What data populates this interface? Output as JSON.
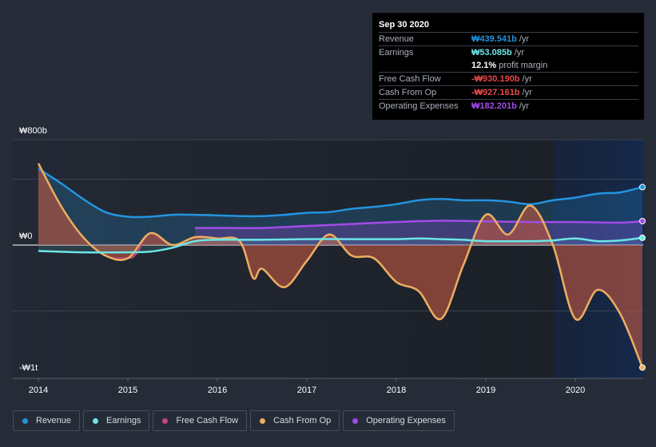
{
  "tooltip": {
    "date": "Sep 30 2020",
    "rows": [
      {
        "label": "Revenue",
        "value": "₩439.541b",
        "unit": "/yr",
        "color": "#2394df"
      },
      {
        "label": "Earnings",
        "value": "₩53.085b",
        "unit": "/yr",
        "color": "#6ce5e8"
      },
      {
        "label": "",
        "value": "12.1%",
        "unit": "profit margin",
        "color": "#ffffff"
      },
      {
        "label": "Free Cash Flow",
        "value": "-₩930.190b",
        "unit": "/yr",
        "color": "#e84a4a"
      },
      {
        "label": "Cash From Op",
        "value": "-₩927.161b",
        "unit": "/yr",
        "color": "#e84a4a"
      },
      {
        "label": "Operating Expenses",
        "value": "₩182.201b",
        "unit": "/yr",
        "color": "#a24be8"
      }
    ]
  },
  "legend": [
    {
      "label": "Revenue",
      "color": "#2394df"
    },
    {
      "label": "Earnings",
      "color": "#6ce5e8"
    },
    {
      "label": "Free Cash Flow",
      "color": "#c5437f"
    },
    {
      "label": "Cash From Op",
      "color": "#e8ae5f"
    },
    {
      "label": "Operating Expenses",
      "color": "#a24be8"
    }
  ],
  "chart_data": {
    "type": "line",
    "title": "",
    "xlabel": "",
    "ylabel": "",
    "ylim": [
      -1000,
      800
    ],
    "xlim": [
      2013.9,
      2020.75
    ],
    "y_ticks": [
      {
        "value": 800,
        "label": "₩800b"
      },
      {
        "value": 0,
        "label": "₩0"
      },
      {
        "value": -1000,
        "label": "-₩1t"
      }
    ],
    "gridlines_at": [
      800,
      500,
      0,
      -500
    ],
    "x_ticks": [
      "2014",
      "2015",
      "2016",
      "2017",
      "2018",
      "2019",
      "2020"
    ],
    "x_tick_values": [
      2014,
      2015,
      2016,
      2017,
      2018,
      2019,
      2020
    ],
    "forecast_shade_from": 2019.75,
    "legend_position": "bottom-left",
    "series": [
      {
        "name": "Revenue",
        "color": "#2394df",
        "x": [
          2014.0,
          2014.25,
          2014.5,
          2014.75,
          2015.0,
          2015.25,
          2015.5,
          2015.75,
          2016.0,
          2016.25,
          2016.5,
          2016.75,
          2017.0,
          2017.25,
          2017.5,
          2017.75,
          2018.0,
          2018.25,
          2018.5,
          2018.75,
          2019.0,
          2019.25,
          2019.5,
          2019.75,
          2020.0,
          2020.25,
          2020.5,
          2020.75
        ],
        "values": [
          580,
          470,
          350,
          250,
          215,
          215,
          230,
          230,
          225,
          220,
          220,
          230,
          245,
          250,
          275,
          290,
          310,
          340,
          350,
          340,
          340,
          330,
          310,
          340,
          360,
          390,
          400,
          440
        ]
      },
      {
        "name": "Earnings",
        "color": "#6ce5e8",
        "x": [
          2014.0,
          2014.5,
          2015.0,
          2015.25,
          2015.5,
          2015.75,
          2016.0,
          2016.5,
          2017.0,
          2017.5,
          2018.0,
          2018.25,
          2018.5,
          2018.75,
          2019.0,
          2019.5,
          2019.75,
          2020.0,
          2020.25,
          2020.5,
          2020.75
        ],
        "values": [
          -45,
          -55,
          -55,
          -50,
          -20,
          30,
          40,
          40,
          45,
          45,
          45,
          50,
          45,
          40,
          30,
          30,
          35,
          50,
          30,
          35,
          55
        ]
      },
      {
        "name": "Free Cash Flow",
        "color": "#c5437f",
        "x": [
          2014.0,
          2014.25,
          2014.5,
          2014.75,
          2015.0,
          2015.1,
          2015.25,
          2015.5,
          2015.75,
          2016.0,
          2016.25,
          2016.4,
          2016.5,
          2016.75,
          2017.0,
          2017.25,
          2017.5,
          2017.75,
          2018.0,
          2018.25,
          2018.5,
          2018.75,
          2019.0,
          2019.25,
          2019.5,
          2019.75,
          2020.0,
          2020.25,
          2020.5,
          2020.75
        ],
        "values": [
          620,
          300,
          60,
          -80,
          -100,
          -60,
          90,
          0,
          60,
          50,
          30,
          -250,
          -180,
          -320,
          -120,
          80,
          -80,
          -100,
          -280,
          -350,
          -560,
          -150,
          230,
          80,
          300,
          0,
          -560,
          -340,
          -520,
          -930
        ]
      },
      {
        "name": "Cash From Op",
        "color": "#e8ae5f",
        "x": [
          2014.0,
          2014.25,
          2014.5,
          2014.75,
          2015.0,
          2015.25,
          2015.5,
          2015.75,
          2016.0,
          2016.25,
          2016.4,
          2016.5,
          2016.75,
          2017.0,
          2017.25,
          2017.5,
          2017.75,
          2018.0,
          2018.25,
          2018.5,
          2018.75,
          2019.0,
          2019.25,
          2019.5,
          2019.75,
          2020.0,
          2020.25,
          2020.5,
          2020.75
        ],
        "values": [
          620,
          300,
          60,
          -80,
          -100,
          90,
          0,
          60,
          50,
          30,
          -250,
          -180,
          -320,
          -120,
          80,
          -80,
          -100,
          -280,
          -350,
          -560,
          -150,
          230,
          80,
          300,
          0,
          -560,
          -340,
          -520,
          -930
        ]
      },
      {
        "name": "Operating Expenses",
        "color": "#a24be8",
        "x": [
          2015.75,
          2016.0,
          2016.5,
          2017.0,
          2017.5,
          2018.0,
          2018.5,
          2019.0,
          2019.5,
          2020.0,
          2020.5,
          2020.75
        ],
        "values": [
          130,
          130,
          130,
          145,
          160,
          175,
          185,
          180,
          175,
          175,
          170,
          182
        ]
      }
    ]
  }
}
